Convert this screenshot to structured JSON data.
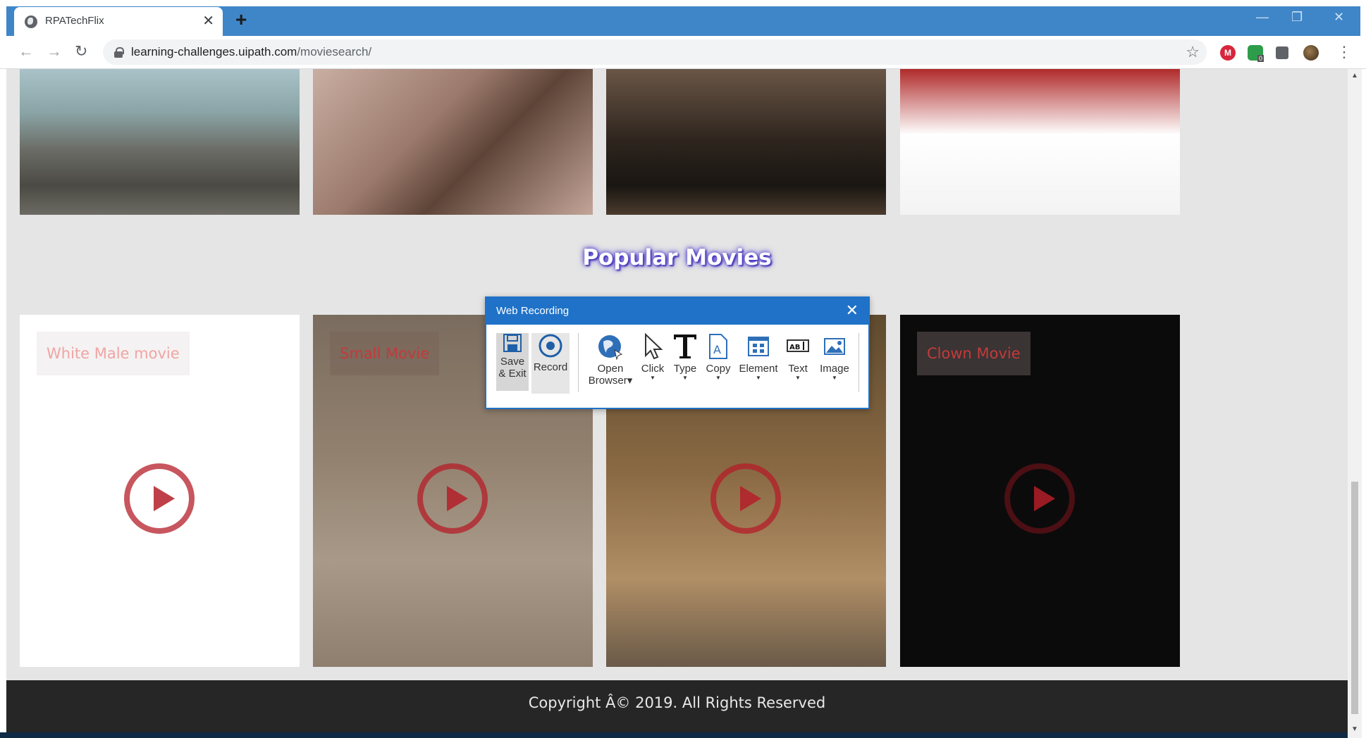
{
  "browser": {
    "tab_title": "RPATechFlix",
    "tab_close": "✕",
    "new_tab": "+",
    "url_domain": "learning-challenges.uipath.com",
    "url_path": "/moviesearch/",
    "ext_m_label": "M",
    "ext_badge": "0",
    "window_controls": [
      "—",
      "❐",
      "✕"
    ],
    "nav": [
      "←",
      "→",
      "↻"
    ],
    "star": "☆",
    "menu": "⋮"
  },
  "page": {
    "section_title": "Popular Movies",
    "movies": [
      {
        "label": "White Male movie"
      },
      {
        "label": "Small Movie"
      },
      {
        "label": ""
      },
      {
        "label": "Clown Movie"
      }
    ],
    "footer": "Copyright Â© 2019. All Rights Reserved"
  },
  "recorder": {
    "title": "Web Recording",
    "close": "✕",
    "tools": [
      {
        "line1": "Save",
        "line2": "& Exit"
      },
      {
        "line1": "Record"
      },
      {
        "line1": "Open",
        "line2": "Browser▾"
      },
      {
        "line1": "Click"
      },
      {
        "line1": "Type"
      },
      {
        "line1": "Copy"
      },
      {
        "line1": "Element"
      },
      {
        "line1": "Text"
      },
      {
        "line1": "Image"
      }
    ]
  },
  "colors": {
    "chrome_blue": "#3e86c8",
    "dialog_blue": "#1f72c8",
    "page_bg": "#e5e5e5",
    "footer_bg": "#262626",
    "label_red": "#c43a3a"
  }
}
